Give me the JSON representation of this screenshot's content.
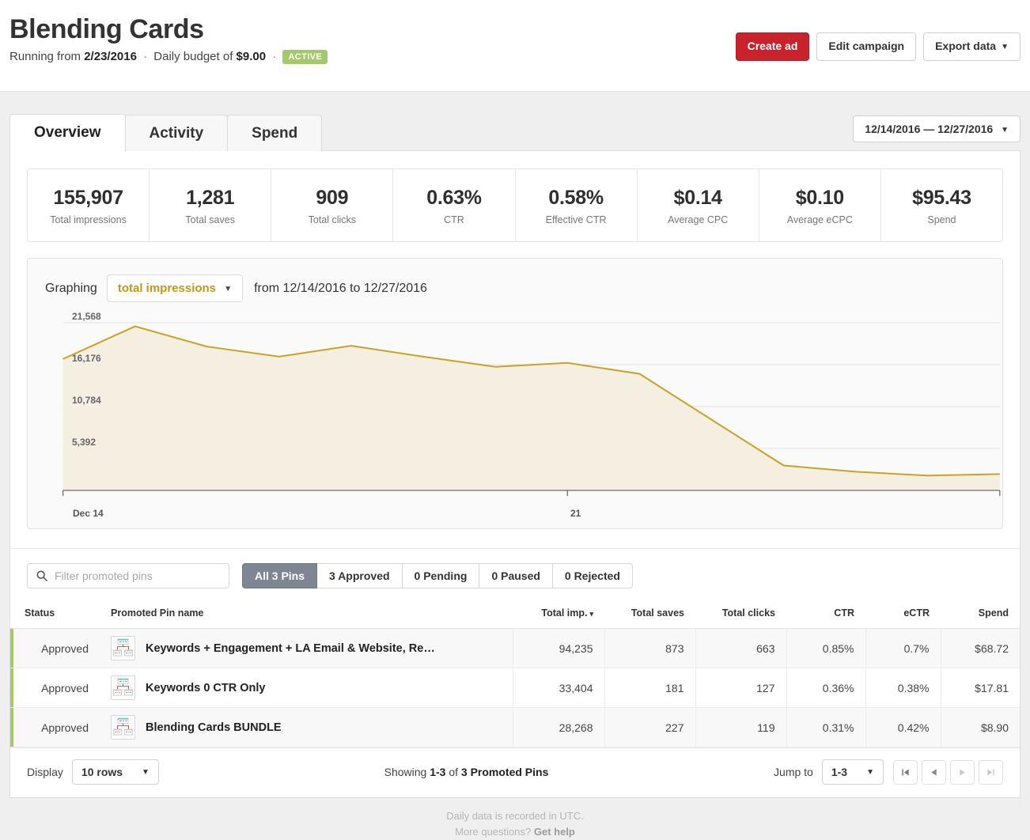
{
  "header": {
    "title": "Blending Cards",
    "running_prefix": "Running from",
    "start_date": "2/23/2016",
    "budget_prefix": "Daily budget of",
    "budget": "$9.00",
    "status_badge": "ACTIVE",
    "dot": "·",
    "buttons": {
      "create_ad": "Create ad",
      "edit_campaign": "Edit campaign",
      "export_data": "Export data"
    },
    "accent_red": "#c8232c",
    "accent_green": "#a3c96a"
  },
  "tabs": [
    {
      "label": "Overview",
      "active": true
    },
    {
      "label": "Activity",
      "active": false
    },
    {
      "label": "Spend",
      "active": false
    }
  ],
  "date_range": "12/14/2016 — 12/27/2016",
  "stats": [
    {
      "value": "155,907",
      "label": "Total impressions"
    },
    {
      "value": "1,281",
      "label": "Total saves"
    },
    {
      "value": "909",
      "label": "Total clicks"
    },
    {
      "value": "0.63%",
      "label": "CTR"
    },
    {
      "value": "0.58%",
      "label": "Effective CTR"
    },
    {
      "value": "$0.14",
      "label": "Average CPC"
    },
    {
      "value": "$0.10",
      "label": "Average eCPC"
    },
    {
      "value": "$95.43",
      "label": "Spend"
    }
  ],
  "graph": {
    "graphing_label": "Graphing",
    "metric": "total impressions",
    "range_text": "from 12/14/2016 to 12/27/2016"
  },
  "chart_data": {
    "type": "area",
    "title": "total impressions",
    "xlabel": "",
    "ylabel": "total impressions",
    "grid": true,
    "legend": "none",
    "line_color": "#c9a227",
    "fill_color": "#f4efe1",
    "ylim": [
      0,
      21568
    ],
    "ytick_labels": [
      "21,568",
      "16,176",
      "10,784",
      "5,392"
    ],
    "ytick_values": [
      21568,
      16176,
      10784,
      5392
    ],
    "xtick_labels": [
      "Dec 14",
      "21"
    ],
    "x": [
      "Dec 14",
      "Dec 15",
      "Dec 16",
      "Dec 17",
      "Dec 18",
      "Dec 19",
      "Dec 20",
      "Dec 21",
      "Dec 22",
      "Dec 23",
      "Dec 24",
      "Dec 25",
      "Dec 26",
      "Dec 27"
    ],
    "values": [
      16900,
      21100,
      18500,
      17200,
      18600,
      17200,
      15900,
      16400,
      15000,
      9100,
      3200,
      2400,
      1900,
      2100
    ]
  },
  "filters": {
    "search_placeholder": "Filter promoted pins",
    "search_value": "",
    "segments": [
      {
        "label": "All 3 Pins",
        "active": true
      },
      {
        "label": "3 Approved",
        "active": false
      },
      {
        "label": "0 Pending",
        "active": false
      },
      {
        "label": "0 Paused",
        "active": false
      },
      {
        "label": "0 Rejected",
        "active": false
      }
    ]
  },
  "table": {
    "columns": [
      "Status",
      "Promoted Pin name",
      "Total imp.",
      "Total saves",
      "Total clicks",
      "CTR",
      "eCTR",
      "Spend"
    ],
    "sorted_column": "Total imp.",
    "sort_caret": "▾",
    "rows": [
      {
        "status": "Approved",
        "name": "Keywords + Engagement + LA Email & Website, Re…",
        "total_imp": "94,235",
        "total_saves": "873",
        "total_clicks": "663",
        "ctr": "0.85%",
        "ectr": "0.7%",
        "spend": "$68.72"
      },
      {
        "status": "Approved",
        "name": "Keywords 0 CTR Only",
        "total_imp": "33,404",
        "total_saves": "181",
        "total_clicks": "127",
        "ctr": "0.36%",
        "ectr": "0.38%",
        "spend": "$17.81"
      },
      {
        "status": "Approved",
        "name": "Blending Cards BUNDLE",
        "total_imp": "28,268",
        "total_saves": "227",
        "total_clicks": "119",
        "ctr": "0.31%",
        "ectr": "0.42%",
        "spend": "$8.90"
      }
    ]
  },
  "pagination": {
    "display_label": "Display",
    "rows_value": "10 rows",
    "showing_prefix": "Showing",
    "showing_range": "1-3",
    "showing_mid": "of",
    "showing_total": "3 Promoted Pins",
    "jump_label": "Jump to",
    "jump_value": "1-3",
    "first_icon": "❘◀",
    "prev_icon": "◀",
    "next_icon": "▶",
    "last_icon": "▶❘"
  },
  "footnote": {
    "line1": "Daily data is recorded in UTC.",
    "line2_prefix": "More questions?",
    "line2_link": "Get help"
  }
}
